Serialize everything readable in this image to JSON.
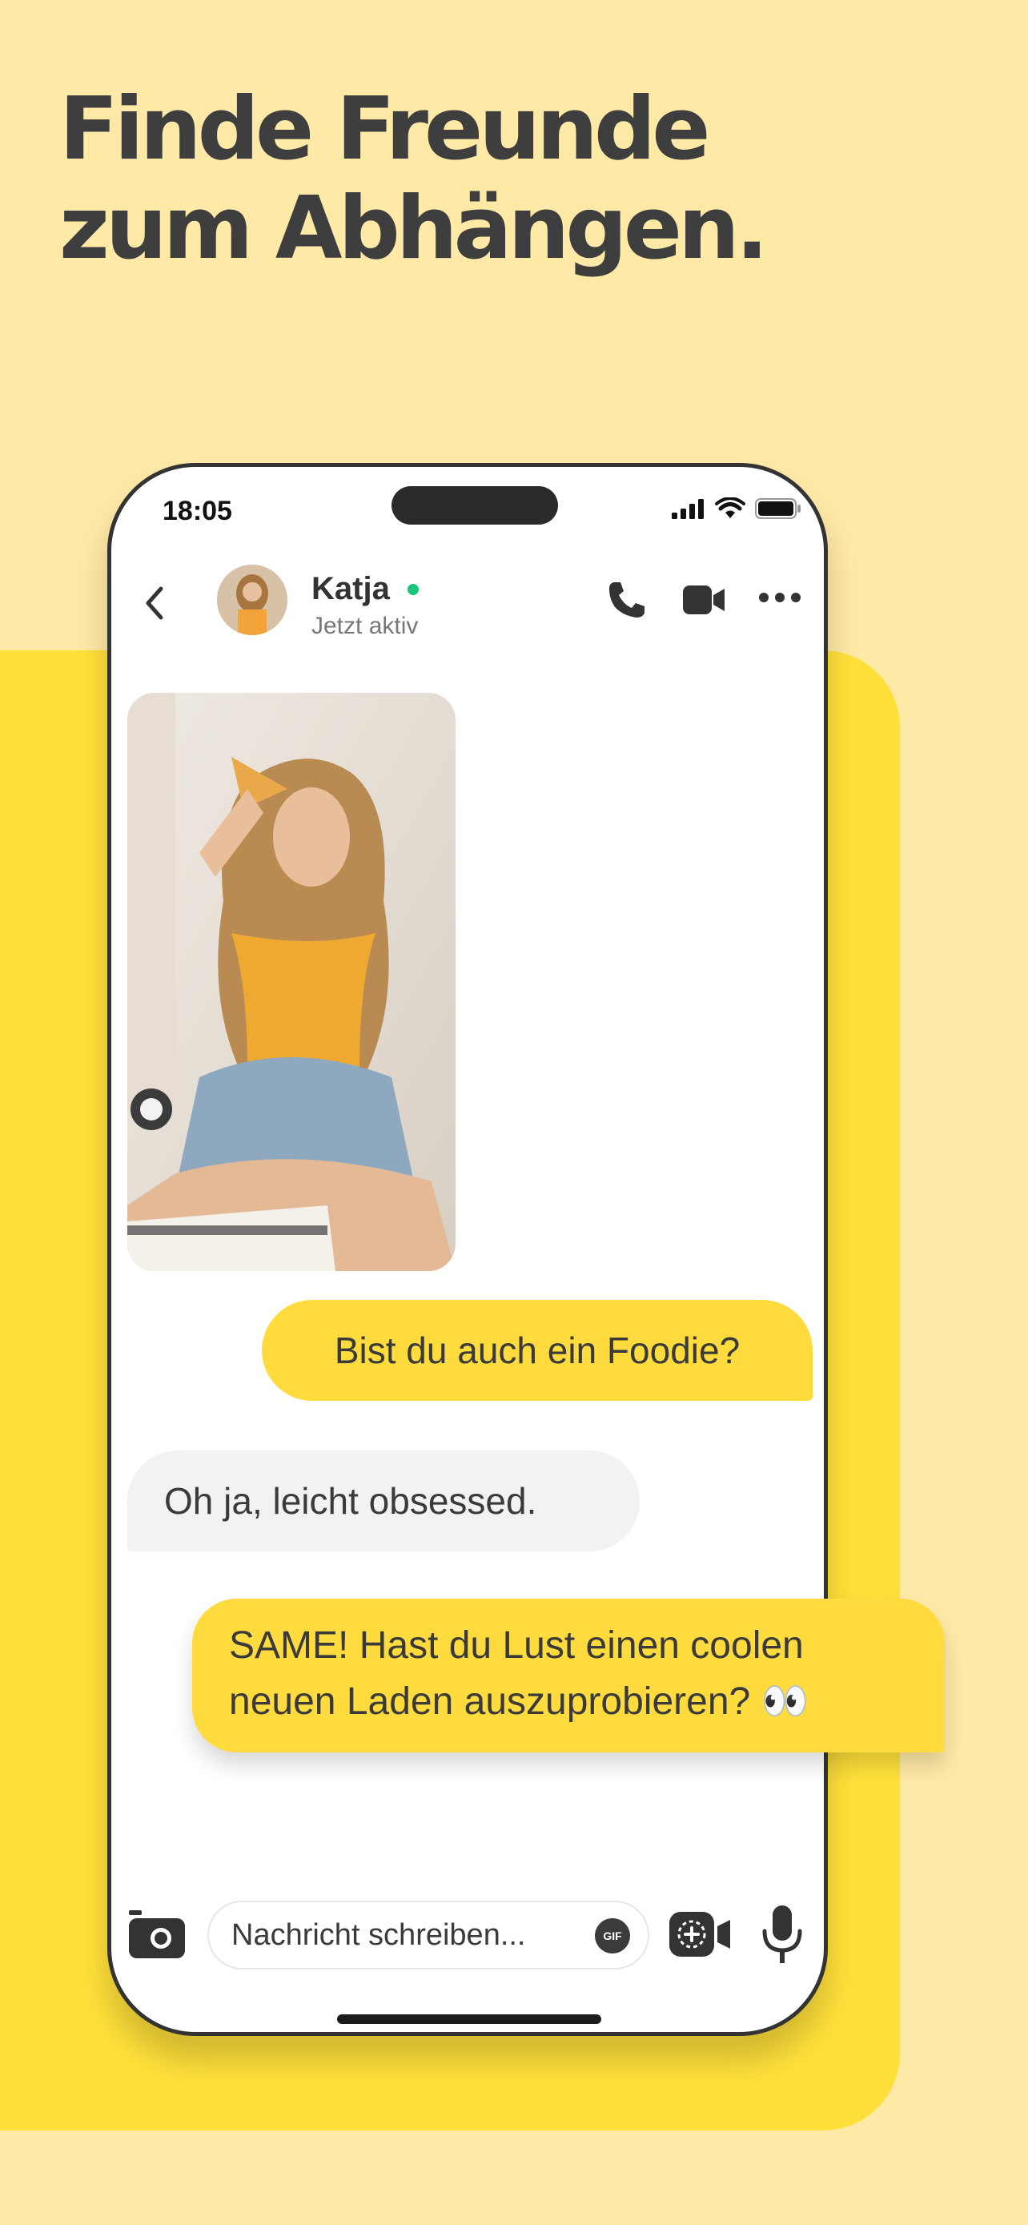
{
  "headline": {
    "line1": "Finde Freunde",
    "line2": "zum Abhängen."
  },
  "status_bar": {
    "time": "18:05"
  },
  "chat_header": {
    "contact_name": "Katja",
    "contact_status": "Jetzt aktiv",
    "online_color": "#19C67B"
  },
  "messages": {
    "sent_1": "Bist du auch ein Foodie?",
    "received_1": "Oh ja, leicht obsessed.",
    "sent_2_line1": "SAME! Hast du Lust einen coolen",
    "sent_2_line2": "neuen Laden auszuprobieren? 👀"
  },
  "composer": {
    "placeholder": "Nachricht schreiben...",
    "gif_label": "GIF"
  },
  "colors": {
    "background": "#FEE9A6",
    "brand_yellow": "#FFE03A",
    "bubble_yellow": "#FFDB3D",
    "bubble_gray": "#F2F2F2"
  }
}
